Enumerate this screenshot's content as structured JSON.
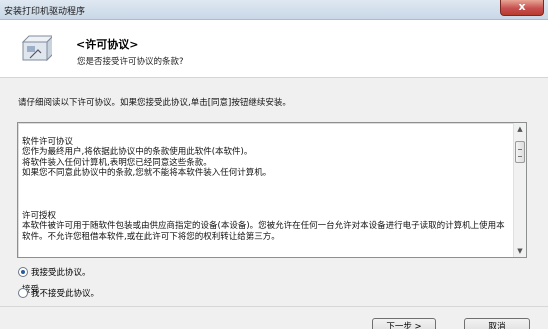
{
  "window": {
    "title": "安装打印机驱动程序",
    "close_glyph": "x"
  },
  "header": {
    "title": "<许可协议>",
    "subtitle": "您是否接受许可协议的条款?",
    "icon": "installer-box-icon"
  },
  "intro_text": "请仔细阅读以下许可协议。如果您接受此协议,单击[同意]按钮继续安装。",
  "license": {
    "paragraphs": [
      "软件许可协议\n您作为最终用户,将依据此协议中的条款使用此软件(本软件)。\n将软件装入任何计算机,表明您已经同意这些条款。\n如果您不同意此协议中的条款,您就不能将本软件装入任何计算机。",
      "许可授权\n本软件被许可用于随软件包装或由供应商指定的设备(本设备)。您被允许在任何一台允许对本设备进行电子读取的计算机上使用本软件。不允许您租借本软件,或在此许可下将您的权利转让给第三方。",
      "接受"
    ]
  },
  "options": [
    {
      "label": "我接受此协议。",
      "checked": true
    },
    {
      "label": "我不接受此协议。",
      "checked": false
    }
  ],
  "buttons": {
    "next": "下一步 >",
    "cancel": "取消"
  },
  "colors": {
    "close_red": "#c75050",
    "radio_accent": "#2b5b9c"
  }
}
